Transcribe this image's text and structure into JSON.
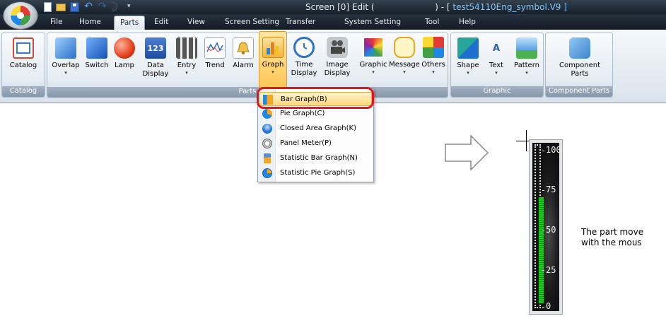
{
  "window": {
    "title_prefix": "Screen [0] Edit (",
    "title_suffix": ") - [ ",
    "file_name": "test54110Eng_symbol.V9 ]"
  },
  "quick_access": [
    "new-icon",
    "open-icon",
    "save-icon",
    "undo-icon",
    "redo-icon",
    "customize-icon"
  ],
  "menu": {
    "tabs": [
      "File",
      "Home",
      "Parts",
      "Edit",
      "View",
      "Screen Setting",
      "Transfer",
      "System Setting",
      "Tool",
      "Help"
    ],
    "active": "Parts"
  },
  "ribbon": {
    "groups": {
      "catalog": "Catalog",
      "parts": "Parts",
      "graphic": "Graphic",
      "component_parts": "Component Parts"
    },
    "buttons": {
      "catalog": "Catalog",
      "overlap": "Overlap",
      "switch": "Switch",
      "lamp": "Lamp",
      "data_display_1": "Data",
      "data_display_2": "Display",
      "data_display_icon_text": "123",
      "entry": "Entry",
      "trend": "Trend",
      "alarm": "Alarm",
      "graph": "Graph",
      "time_display_1": "Time",
      "time_display_2": "Display",
      "image_display_1": "Image",
      "image_display_2": "Display",
      "graphic": "Graphic",
      "message": "Message",
      "others": "Others",
      "shape": "Shape",
      "text": "Text",
      "text_icon_text": "A",
      "pattern": "Pattern",
      "component_parts_1": "Component",
      "component_parts_2": "Parts"
    }
  },
  "graph_menu": {
    "items": [
      {
        "label": "Bar Graph(B)",
        "icon": "bar-graph-icon"
      },
      {
        "label": "Pie Graph(C)",
        "icon": "pie-graph-icon"
      },
      {
        "label": "Closed Area Graph(K)",
        "icon": "closed-area-graph-icon"
      },
      {
        "label": "Panel Meter(P)",
        "icon": "panel-meter-icon"
      },
      {
        "label": "Statistic Bar Graph(N)",
        "icon": "statistic-bar-graph-icon"
      },
      {
        "label": "Statistic Pie Graph(S)",
        "icon": "statistic-pie-graph-icon"
      }
    ],
    "highlighted": "Bar Graph(B)"
  },
  "bar_graph_part": {
    "scale_labels": [
      "100",
      "75",
      "50",
      "25",
      "0"
    ],
    "fill_fraction": 0.66,
    "fill_color": "#1bd11b"
  },
  "note": {
    "line1": "The part move",
    "line2": "with the mous"
  },
  "colors": {
    "callout": "#e0141c",
    "title_bar": "#1c2631"
  }
}
